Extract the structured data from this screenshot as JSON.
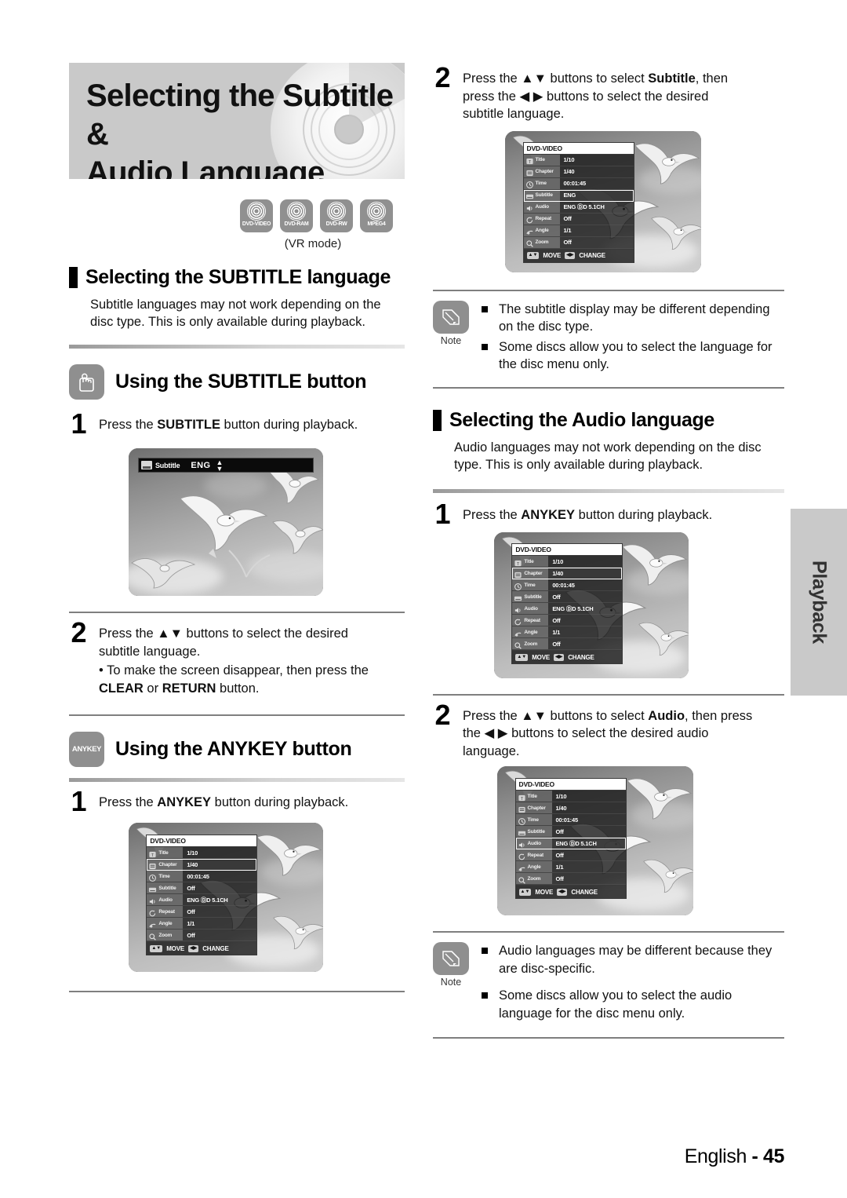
{
  "page": {
    "title_line1": "Selecting the Subtitle &",
    "title_line2": "Audio Language",
    "footer_language": "English",
    "footer_separator": "-",
    "footer_page": "45",
    "side_tab": "Playback"
  },
  "disc_icons": {
    "items": [
      {
        "label": "DVD-VIDEO"
      },
      {
        "label": "DVD-RAM"
      },
      {
        "label": "DVD-RW"
      },
      {
        "label": "MPEG4"
      }
    ],
    "vr_mode_note": "(VR mode)"
  },
  "left": {
    "subtitle_section": {
      "heading": "Selecting the SUBTITLE language",
      "body": "Subtitle languages may not work depending on the disc type. This is only available during playback."
    },
    "subtitle_button": {
      "icon_label": "",
      "heading": "Using the SUBTITLE button",
      "step1_num": "1",
      "step1_pre": "Press the ",
      "step1_bold": "SUBTITLE",
      "step1_post": " button during playback."
    },
    "subtitle_shot": {
      "bar_name": "Subtitle",
      "bar_value": "ENG"
    },
    "step2": {
      "num": "2",
      "line1_pre": "Press the ",
      "line1_arrows": "▲▼",
      "line1_post": " buttons to select the desired",
      "line2": "subtitle language.",
      "bullet_pre": "• To make the screen disappear, then press the",
      "bullet_bold1": "CLEAR",
      "bullet_mid": " or ",
      "bullet_bold2": "RETURN",
      "bullet_post": " button."
    },
    "anykey_button": {
      "icon_label": "ANYKEY",
      "heading": "Using the ANYKEY button",
      "step1_num": "1",
      "step1_pre": "Press the ",
      "step1_bold": "ANYKEY",
      "step1_post": " button during playback."
    },
    "anykey_shot": {
      "header": "DVD-VIDEO",
      "rows": [
        {
          "label": "Title",
          "value": "1/10",
          "icon": "title-icon",
          "selected": false
        },
        {
          "label": "Chapter",
          "value": "1/40",
          "icon": "chapter-icon",
          "selected": true
        },
        {
          "label": "Time",
          "value": "00:01:45",
          "icon": "time-icon",
          "selected": false
        },
        {
          "label": "Subtitle",
          "value": "Off",
          "icon": "subtitle-icon",
          "selected": false
        },
        {
          "label": "Audio",
          "value": "ENG ⒹD 5.1CH",
          "icon": "audio-icon",
          "selected": false
        },
        {
          "label": "Repeat",
          "value": "Off",
          "icon": "repeat-icon",
          "selected": false
        },
        {
          "label": "Angle",
          "value": "1/1",
          "icon": "angle-icon",
          "selected": false
        },
        {
          "label": "Zoom",
          "value": "Off",
          "icon": "zoom-icon",
          "selected": false
        }
      ],
      "foot_move": "MOVE",
      "foot_change": "CHANGE"
    }
  },
  "right": {
    "step2_subtitle": {
      "num": "2",
      "line1_pre": "Press the ",
      "line1_arrows": "▲▼",
      "line1_mid": " buttons to select ",
      "line1_bold": "Subtitle",
      "line1_post": ", then",
      "line2_pre": "press the ",
      "line2_arrows": "◀ ▶",
      "line2_post": " buttons to select the desired",
      "line3": "subtitle language."
    },
    "subtitle_osd": {
      "header": "DVD-VIDEO",
      "rows": [
        {
          "label": "Title",
          "value": "1/10",
          "icon": "title-icon",
          "selected": false
        },
        {
          "label": "Chapter",
          "value": "1/40",
          "icon": "chapter-icon",
          "selected": false
        },
        {
          "label": "Time",
          "value": "00:01:45",
          "icon": "time-icon",
          "selected": false
        },
        {
          "label": "Subtitle",
          "value": "ENG",
          "icon": "subtitle-icon",
          "selected": true
        },
        {
          "label": "Audio",
          "value": "ENG ⒹD 5.1CH",
          "icon": "audio-icon",
          "selected": false
        },
        {
          "label": "Repeat",
          "value": "Off",
          "icon": "repeat-icon",
          "selected": false
        },
        {
          "label": "Angle",
          "value": "1/1",
          "icon": "angle-icon",
          "selected": false
        },
        {
          "label": "Zoom",
          "value": "Off",
          "icon": "zoom-icon",
          "selected": false
        }
      ],
      "foot_move": "MOVE",
      "foot_change": "CHANGE"
    },
    "note_subtitle": {
      "caption": "Note",
      "items": [
        "The subtitle display may be different depending on the disc type.",
        "Some discs allow you to select the language for the disc menu only."
      ]
    },
    "audio_section": {
      "heading": "Selecting the Audio language",
      "body": "Audio languages may not work depending on the disc type. This is only available during playback.",
      "step1_num": "1",
      "step1_pre": "Press the ",
      "step1_bold": "ANYKEY",
      "step1_post": " button during playback."
    },
    "audio_osd_1": {
      "header": "DVD-VIDEO",
      "rows": [
        {
          "label": "Title",
          "value": "1/10",
          "icon": "title-icon",
          "selected": false
        },
        {
          "label": "Chapter",
          "value": "1/40",
          "icon": "chapter-icon",
          "selected": true
        },
        {
          "label": "Time",
          "value": "00:01:45",
          "icon": "time-icon",
          "selected": false
        },
        {
          "label": "Subtitle",
          "value": "Off",
          "icon": "subtitle-icon",
          "selected": false
        },
        {
          "label": "Audio",
          "value": "ENG ⒹD 5.1CH",
          "icon": "audio-icon",
          "selected": false
        },
        {
          "label": "Repeat",
          "value": "Off",
          "icon": "repeat-icon",
          "selected": false
        },
        {
          "label": "Angle",
          "value": "1/1",
          "icon": "angle-icon",
          "selected": false
        },
        {
          "label": "Zoom",
          "value": "Off",
          "icon": "zoom-icon",
          "selected": false
        }
      ],
      "foot_move": "MOVE",
      "foot_change": "CHANGE"
    },
    "step2_audio": {
      "num": "2",
      "line1_pre": "Press the ",
      "line1_arrows": "▲▼",
      "line1_mid": " buttons to select ",
      "line1_bold": "Audio",
      "line1_post": ", then press",
      "line2_pre": "the ",
      "line2_arrows": "◀ ▶",
      "line2_post": " buttons to select the desired audio",
      "line3": "language."
    },
    "audio_osd_2": {
      "header": "DVD-VIDEO",
      "rows": [
        {
          "label": "Title",
          "value": "1/10",
          "icon": "title-icon",
          "selected": false
        },
        {
          "label": "Chapter",
          "value": "1/40",
          "icon": "chapter-icon",
          "selected": false
        },
        {
          "label": "Time",
          "value": "00:01:45",
          "icon": "time-icon",
          "selected": false
        },
        {
          "label": "Subtitle",
          "value": "Off",
          "icon": "subtitle-icon",
          "selected": false
        },
        {
          "label": "Audio",
          "value": "ENG ⒹD 5.1CH",
          "icon": "audio-icon",
          "selected": true
        },
        {
          "label": "Repeat",
          "value": "Off",
          "icon": "repeat-icon",
          "selected": false
        },
        {
          "label": "Angle",
          "value": "1/1",
          "icon": "angle-icon",
          "selected": false
        },
        {
          "label": "Zoom",
          "value": "Off",
          "icon": "zoom-icon",
          "selected": false
        }
      ],
      "foot_move": "MOVE",
      "foot_change": "CHANGE"
    },
    "note_audio": {
      "caption": "Note",
      "items": [
        "Audio languages may be different because they are disc-specific.",
        "Some discs allow you to select the audio language for the disc menu only."
      ]
    }
  }
}
